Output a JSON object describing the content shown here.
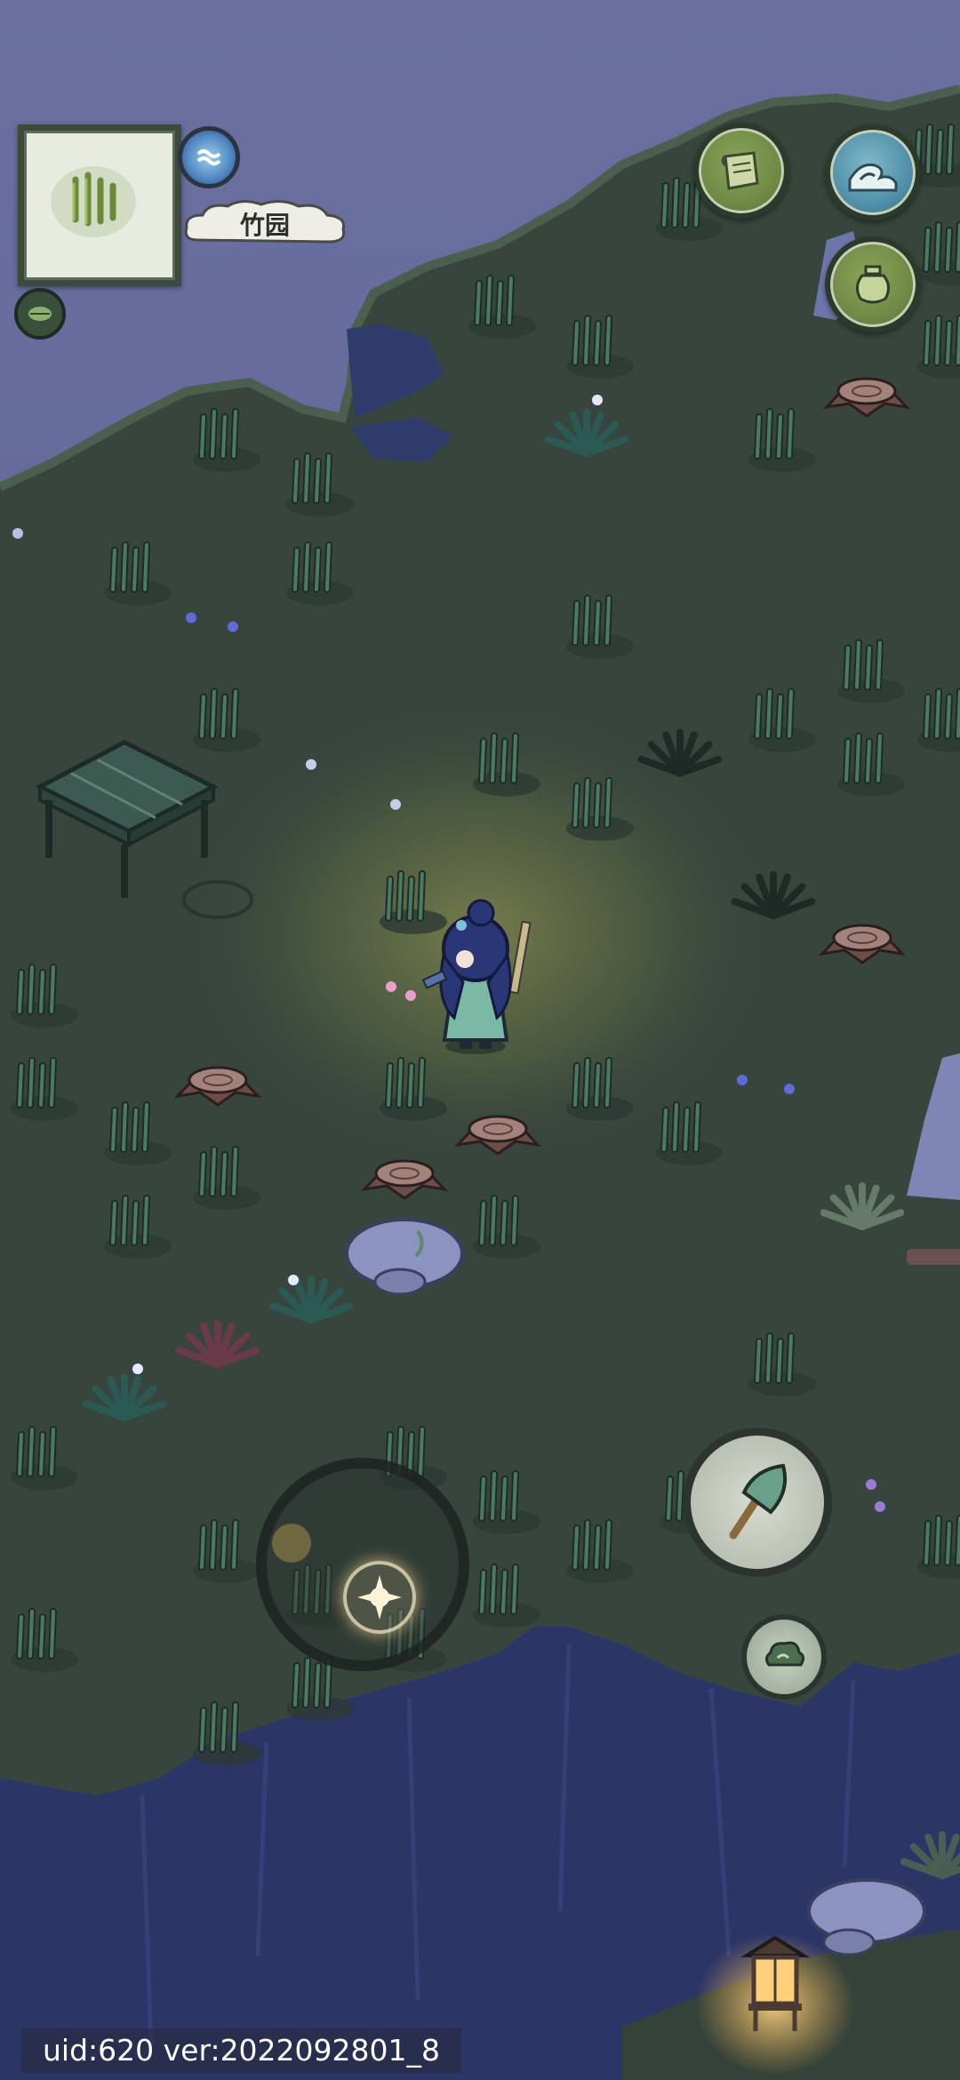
{
  "location": {
    "name": "竹园"
  },
  "footer": {
    "version_text": "uid:620 ver:2022092801_8"
  },
  "hud": {
    "top_right_buttons": [
      "scroll-icon",
      "wave-icon",
      "pot-icon"
    ],
    "left_buttons": [
      "map-zoom-icon",
      "water-orb-icon",
      "leaf-icon"
    ],
    "bottom_right_buttons": [
      "axe-icon",
      "cloud-icon"
    ],
    "joystick": "joystick"
  },
  "colors": {
    "grass": "#37453d",
    "grass_light": "#3f5044",
    "sky": "#5c6390",
    "cliff": "#2f3b6b",
    "bamboo": "#4b7a63",
    "ui_green": "#7a9650",
    "ui_dark": "#2c3a2c"
  }
}
